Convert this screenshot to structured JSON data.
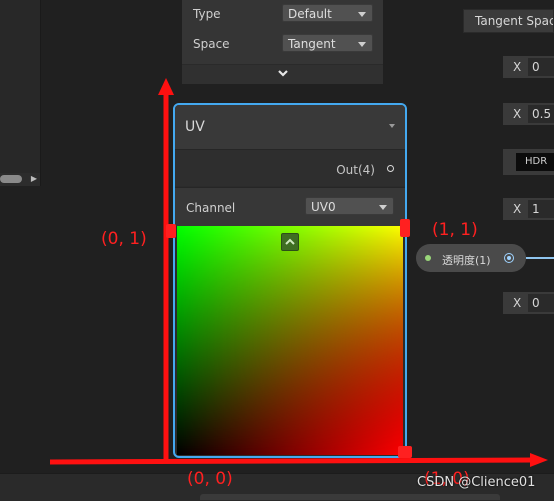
{
  "settings": {
    "type_label": "Type",
    "type_value": "Default",
    "space_label": "Space",
    "space_value": "Tangent"
  },
  "node": {
    "title": "UV",
    "output_label": "Out(4)",
    "channel_label": "Channel",
    "channel_value": "UV0"
  },
  "property_pill": {
    "label": "透明度(1)"
  },
  "right_panel": {
    "tangent_space_label": "Tangent Space",
    "fields": [
      {
        "axis": "X",
        "value": "0"
      },
      {
        "axis": "X",
        "value": "0.5"
      },
      {
        "axis": "X",
        "value": "1"
      },
      {
        "axis": "X",
        "value": "0"
      }
    ],
    "hdr_label": "HDR"
  },
  "annotations": {
    "top_left": "(0, 1)",
    "top_right": "(1, 1)",
    "bottom_left": "(0, 0)",
    "bottom_right": "(1, 0)"
  },
  "colors": {
    "node_border": "#44a9f0",
    "annotation_red": "#ff1010",
    "uv_green": "#00ff00",
    "uv_red": "#ff0000",
    "uv_yellow": "#ffff00"
  },
  "watermark": "CSDN @Clience01"
}
